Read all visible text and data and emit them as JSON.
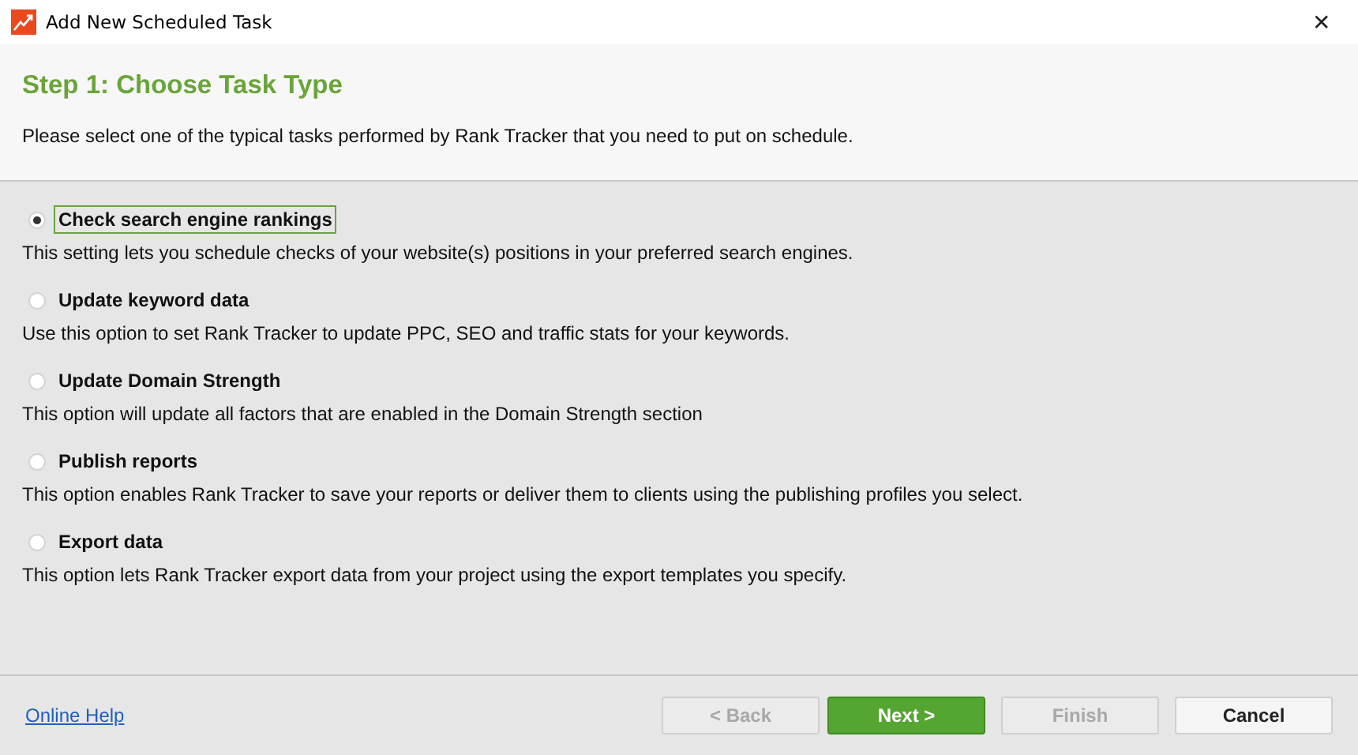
{
  "window": {
    "title": "Add New Scheduled Task",
    "close": "✕"
  },
  "header": {
    "title": "Step 1: Choose Task Type",
    "subtitle": "Please select one of the typical tasks performed by Rank Tracker that you need to put on schedule."
  },
  "options": [
    {
      "label": "Check search engine rankings",
      "description": "This setting lets you schedule checks of your website(s) positions in your preferred search engines.",
      "selected": true
    },
    {
      "label": "Update keyword data",
      "description": "Use this option to set Rank Tracker to update PPC, SEO and traffic stats for your keywords.",
      "selected": false
    },
    {
      "label": "Update Domain Strength",
      "description": "This option will update all factors that are enabled in the Domain Strength section",
      "selected": false
    },
    {
      "label": "Publish reports",
      "description": "This option enables Rank Tracker to save your reports or deliver them to clients using the publishing profiles you select.",
      "selected": false
    },
    {
      "label": "Export data",
      "description": "This option lets Rank Tracker export data from your project using the export templates you specify.",
      "selected": false
    }
  ],
  "footer": {
    "help_link": "Online Help",
    "buttons": [
      {
        "label": "< Back",
        "kind": "default",
        "disabled": true
      },
      {
        "label": "Next >",
        "kind": "primary",
        "disabled": false
      },
      {
        "label": "Finish",
        "kind": "default",
        "disabled": true
      },
      {
        "label": "Cancel",
        "kind": "default",
        "disabled": false
      }
    ]
  }
}
